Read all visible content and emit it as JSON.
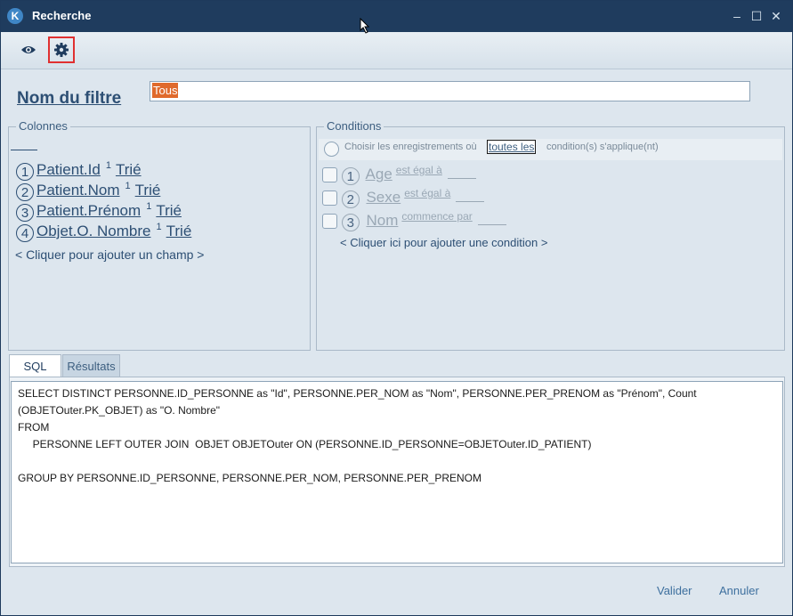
{
  "window": {
    "title": "Recherche",
    "logo": "K",
    "controls": [
      "–",
      "☐",
      "✕"
    ]
  },
  "toolbar": {
    "icons": [
      "eye-icon",
      "gear-icon"
    ]
  },
  "filter": {
    "label": "Nom du filtre",
    "value": "Tous"
  },
  "columns": {
    "legend": "Colonnes",
    "items": [
      {
        "num": "1",
        "field": "Patient.Id",
        "sort_order": "1",
        "sort": "Trié"
      },
      {
        "num": "2",
        "field": "Patient.Nom",
        "sort_order": "1",
        "sort": "Trié"
      },
      {
        "num": "3",
        "field": "Patient.Prénom",
        "sort_order": "1",
        "sort": "Trié"
      },
      {
        "num": "4",
        "field": "Objet.O. Nombre",
        "sort_order": "1",
        "sort": "Trié"
      }
    ],
    "add_label": "< Cliquer pour ajouter un champ >"
  },
  "conditions": {
    "legend": "Conditions",
    "header_prefix": "Choisir les enregistrements où",
    "header_mode": "toutes les",
    "header_suffix": "condition(s) s'applique(nt)",
    "items": [
      {
        "num": "1",
        "field": "Age",
        "op": "est égal à"
      },
      {
        "num": "2",
        "field": "Sexe",
        "op": "est égal à"
      },
      {
        "num": "3",
        "field": "Nom",
        "op": "commence par"
      }
    ],
    "add_label": "< Cliquer ici pour ajouter une condition >"
  },
  "tabs": [
    "SQL",
    "Résultats"
  ],
  "sql_text": "SELECT DISTINCT PERSONNE.ID_PERSONNE as \"Id\", PERSONNE.PER_NOM as \"Nom\", PERSONNE.PER_PRENOM as \"Prénom\", Count\n(OBJETOuter.PK_OBJET) as \"O. Nombre\"\nFROM\n     PERSONNE LEFT OUTER JOIN  OBJET OBJETOuter ON (PERSONNE.ID_PERSONNE=OBJETOuter.ID_PATIENT)\n\nGROUP BY PERSONNE.ID_PERSONNE, PERSONNE.PER_NOM, PERSONNE.PER_PRENOM",
  "footer": {
    "validate": "Valider",
    "cancel": "Annuler"
  }
}
